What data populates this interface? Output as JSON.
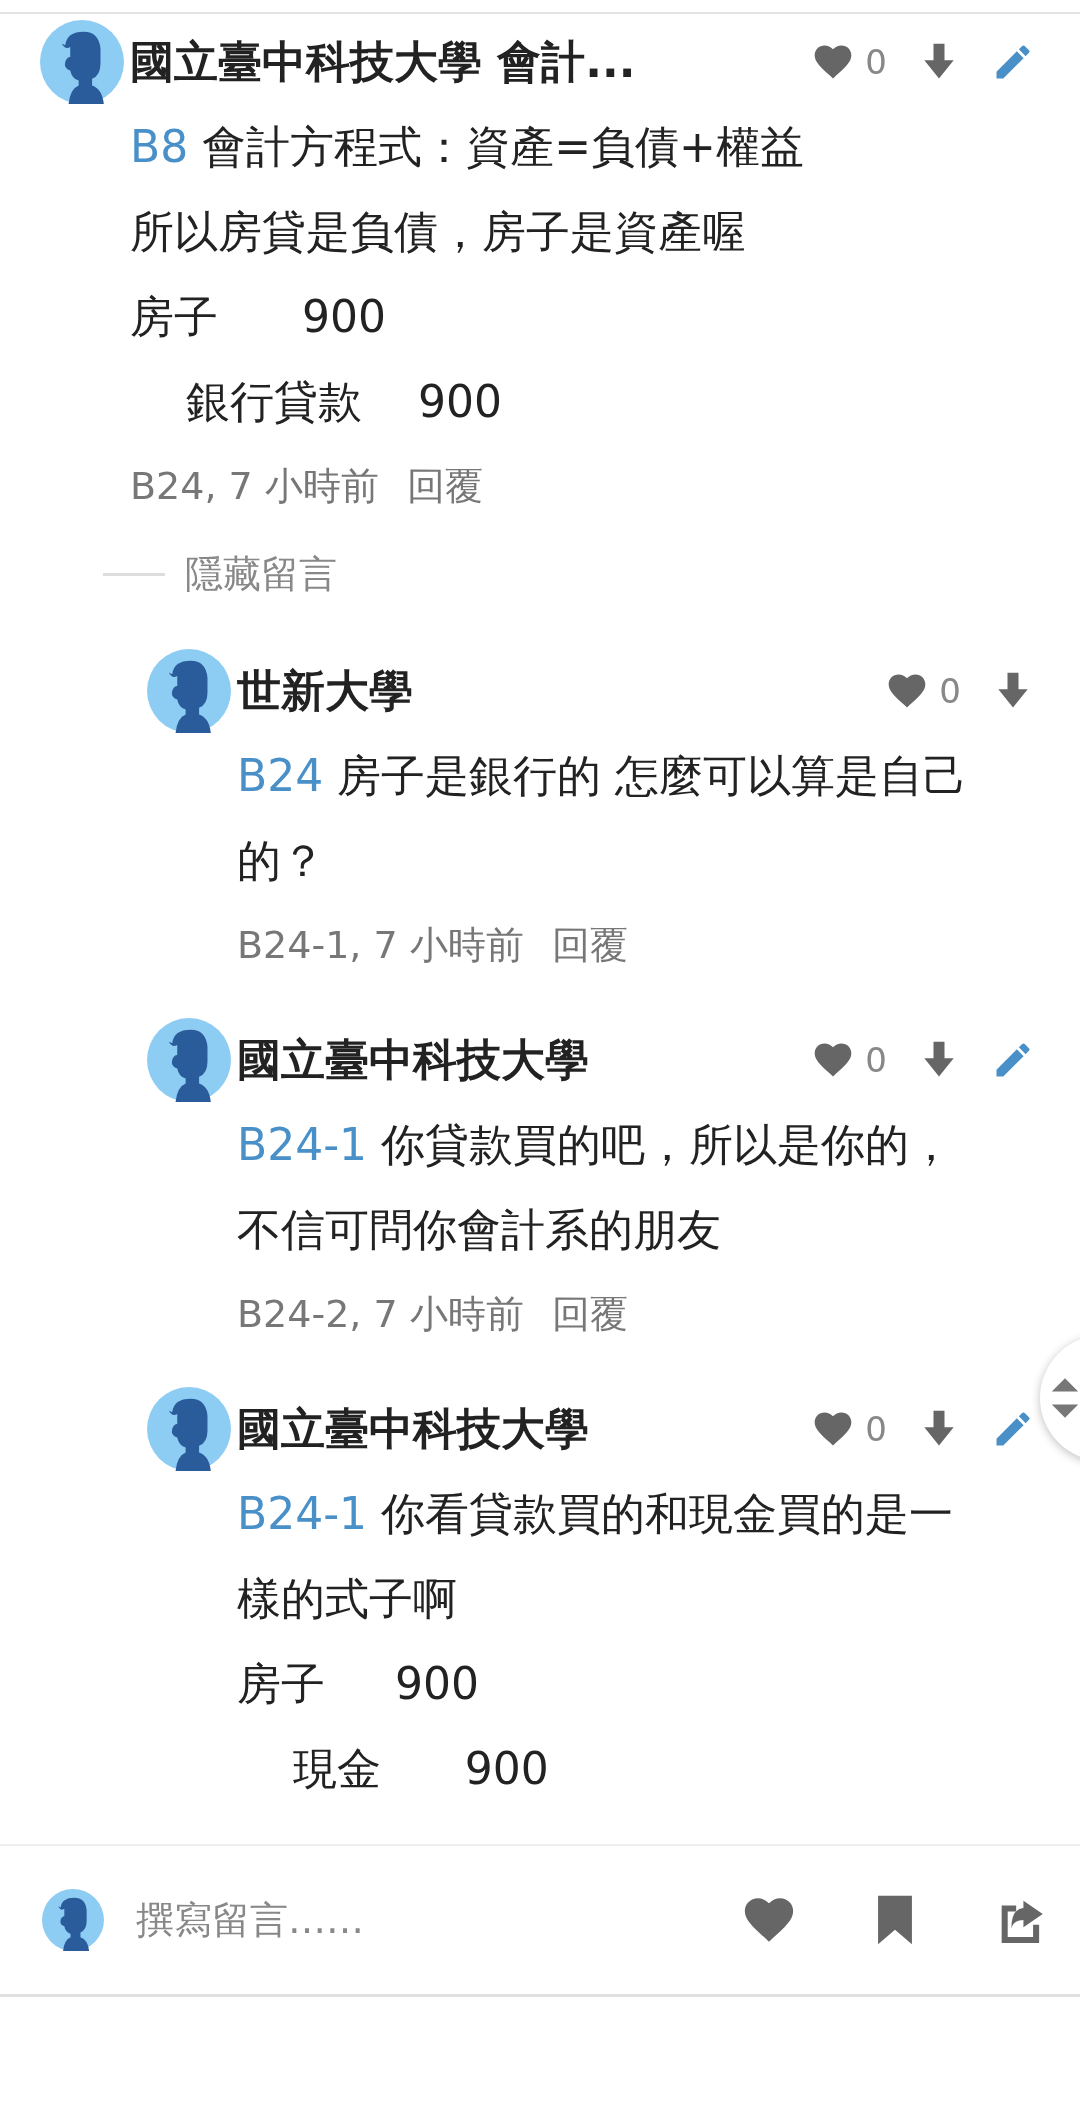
{
  "comments": [
    {
      "author": "國立臺中科技大學 會計...",
      "likes": "0",
      "editable": true,
      "ref": "B8",
      "body": [
        "會計方程式：資產=負債+權益",
        "所以房貸是負債，房子是資產喔",
        "房子      900",
        "    銀行貸款    900"
      ],
      "meta": "B24, 7 小時前",
      "reply_label": "回覆",
      "hide_label": "隱藏留言",
      "replies": [
        {
          "author": "世新大學",
          "likes": "0",
          "editable": false,
          "ref": "B24",
          "body": [
            "房子是銀行的 怎麼可以算是自己的？"
          ],
          "meta": "B24-1, 7 小時前",
          "reply_label": "回覆"
        },
        {
          "author": "國立臺中科技大學",
          "likes": "0",
          "editable": true,
          "ref": "B24-1",
          "body": [
            "你貸款買的吧，所以是你的，不信可問你會計系的朋友"
          ],
          "meta": "B24-2, 7 小時前",
          "reply_label": "回覆"
        },
        {
          "author": "國立臺中科技大學",
          "likes": "0",
          "editable": true,
          "ref": "B24-1",
          "body": [
            "你看貸款買的和現金買的是一樣的式子啊",
            "房子     900",
            "    現金      900"
          ]
        }
      ]
    }
  ],
  "composer": {
    "placeholder": "撰寫留言……"
  }
}
